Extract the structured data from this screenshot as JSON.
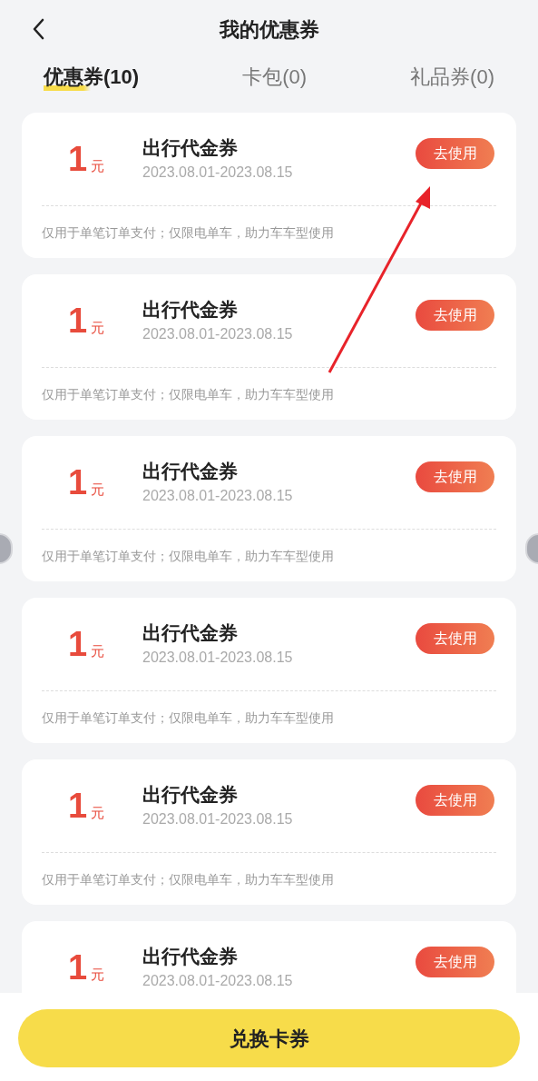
{
  "header": {
    "title": "我的优惠券"
  },
  "tabs": [
    {
      "label": "优惠券(10)",
      "selected": true
    },
    {
      "label": "卡包(0)",
      "selected": false
    },
    {
      "label": "礼品券(0)",
      "selected": false
    }
  ],
  "coupons": [
    {
      "amount": "1",
      "unit": "元",
      "title": "出行代金券",
      "dates": "2023.08.01-2023.08.15",
      "action": "去使用",
      "note": "仅用于单笔订单支付；仅限电单车，助力车车型使用"
    },
    {
      "amount": "1",
      "unit": "元",
      "title": "出行代金券",
      "dates": "2023.08.01-2023.08.15",
      "action": "去使用",
      "note": "仅用于单笔订单支付；仅限电单车，助力车车型使用"
    },
    {
      "amount": "1",
      "unit": "元",
      "title": "出行代金券",
      "dates": "2023.08.01-2023.08.15",
      "action": "去使用",
      "note": "仅用于单笔订单支付；仅限电单车，助力车车型使用"
    },
    {
      "amount": "1",
      "unit": "元",
      "title": "出行代金券",
      "dates": "2023.08.01-2023.08.15",
      "action": "去使用",
      "note": "仅用于单笔订单支付；仅限电单车，助力车车型使用"
    },
    {
      "amount": "1",
      "unit": "元",
      "title": "出行代金券",
      "dates": "2023.08.01-2023.08.15",
      "action": "去使用",
      "note": "仅用于单笔订单支付；仅限电单车，助力车车型使用"
    },
    {
      "amount": "1",
      "unit": "元",
      "title": "出行代金券",
      "dates": "2023.08.01-2023.08.15",
      "action": "去使用"
    }
  ],
  "bottom_button": "兑换卡券"
}
